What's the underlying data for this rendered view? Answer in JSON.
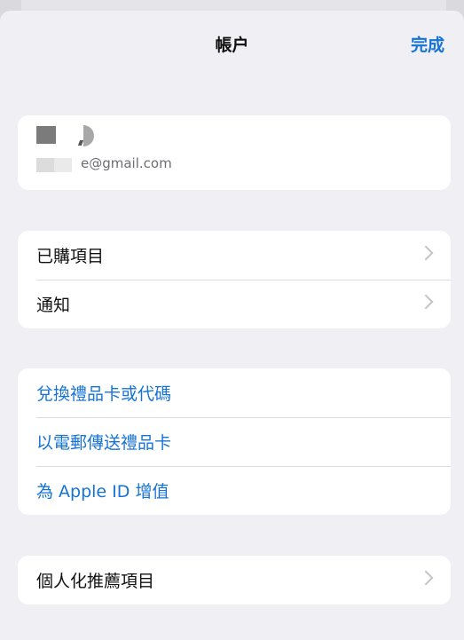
{
  "nav": {
    "title": "帳户",
    "done_label": "完成"
  },
  "account": {
    "email_suffix": "e@gmail.com"
  },
  "group1": [
    {
      "label": "已購項目",
      "chevron": "chevron-right-icon"
    },
    {
      "label": "通知",
      "chevron": "chevron-right-icon"
    }
  ],
  "group2": [
    {
      "label": "兌換禮品卡或代碼"
    },
    {
      "label": "以電郵傳送禮品卡"
    },
    {
      "label": "為 Apple ID 增值"
    }
  ],
  "group3": [
    {
      "label": "個人化推薦項目",
      "chevron": "chevron-right-icon"
    }
  ],
  "colors": {
    "accent": "#1673d6",
    "background": "#efeff4",
    "card": "#ffffff"
  }
}
